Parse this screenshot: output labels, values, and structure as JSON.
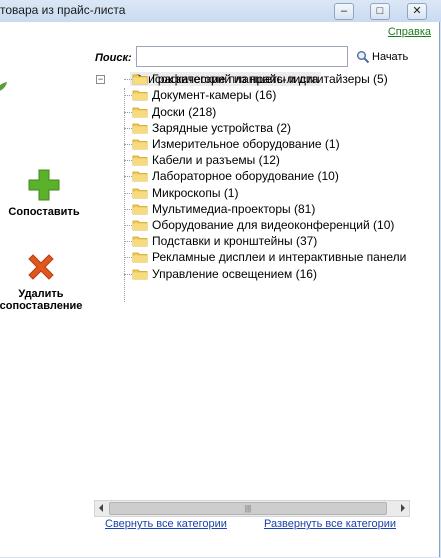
{
  "window": {
    "title": "товара из прайс-листа",
    "minimize": "‒",
    "maximize": "□",
    "close": "✕"
  },
  "help_link": "Справка",
  "actions": {
    "match_label": "Сопоставить",
    "unmatch_label_1": "Удалить",
    "unmatch_label_2": "сопоставление"
  },
  "search": {
    "label": "Поиск:",
    "value": "",
    "placeholder": "",
    "button_label": "Начать"
  },
  "tree": {
    "toggle": "−",
    "root_label": "Список категорий из прайс-листа",
    "items": [
      {
        "label": "Аксессуары для проекторов (749)"
      },
      {
        "label": "Графические планшеты и дигитайзеры (5)"
      },
      {
        "label": "Документ-камеры (16)"
      },
      {
        "label": "Доски (218)"
      },
      {
        "label": "Зарядные устройства (2)"
      },
      {
        "label": "Измерительное оборудование (1)"
      },
      {
        "label": "Кабели и разъемы (12)"
      },
      {
        "label": "Лабораторное оборудование (10)"
      },
      {
        "label": "Микроскопы (1)"
      },
      {
        "label": "Мультимедиа-проекторы (81)"
      },
      {
        "label": "Оборудование для видеоконференций (10)"
      },
      {
        "label": "Подставки и кронштейны (37)"
      },
      {
        "label": "Рекламные дисплеи и интерактивные панели"
      },
      {
        "label": "Управление освещением (16)"
      }
    ]
  },
  "links": {
    "collapse_all": "Свернуть все категории",
    "expand_all": "Развернуть все категории"
  },
  "colors": {
    "help_link": "#1f7a1f",
    "link": "#1a3fb0",
    "match_icon": "#5bb02c",
    "unmatch_icon": "#e0561d",
    "folder": "#f2c94c"
  },
  "icons": {
    "match": "green-plus-icon",
    "unmatch": "orange-x-icon",
    "search": "magnifier-icon",
    "folder": "folder-icon"
  }
}
